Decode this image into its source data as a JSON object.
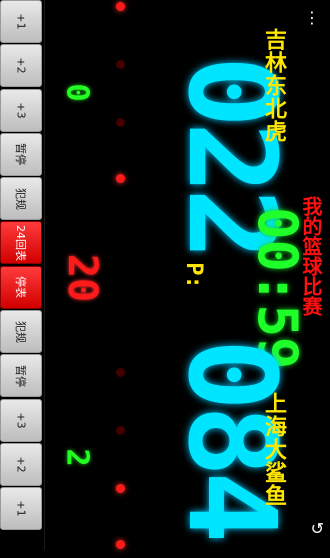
{
  "left_buttons": [
    {
      "label": "+1",
      "name": "home-plus1-button",
      "red": false
    },
    {
      "label": "+2",
      "name": "home-plus2-button",
      "red": false
    },
    {
      "label": "+3",
      "name": "home-plus3-button",
      "red": false
    },
    {
      "label": "暂停",
      "name": "home-timeout-button",
      "red": false
    },
    {
      "label": "犯规",
      "name": "home-foul-button",
      "red": false
    },
    {
      "label": "24回表",
      "name": "reset-24-button",
      "red": true
    },
    {
      "label": "停表",
      "name": "stop-clock-button",
      "red": true
    },
    {
      "label": "犯规",
      "name": "away-foul-button",
      "red": false
    },
    {
      "label": "暂停",
      "name": "away-timeout-button",
      "red": false
    },
    {
      "label": "+3",
      "name": "away-plus3-button",
      "red": false
    },
    {
      "label": "+2",
      "name": "away-plus2-button",
      "red": false
    },
    {
      "label": "+1",
      "name": "away-plus1-button",
      "red": false
    }
  ],
  "home": {
    "team": "吉林东北虎",
    "score": "022",
    "fouls": "0"
  },
  "away": {
    "team": "上海大鲨鱼",
    "score": "084",
    "fouls": "2"
  },
  "shot_clock": "20",
  "game_title": "我的篮球比赛",
  "game_clock": "00:59",
  "period_label": "P:",
  "icons": {
    "menu": "menu-icon",
    "undo": "undo-icon"
  },
  "colors": {
    "score": "#00e5ff",
    "team": "#ffe600",
    "clock": "#1fff2a",
    "title": "#ff1010"
  }
}
